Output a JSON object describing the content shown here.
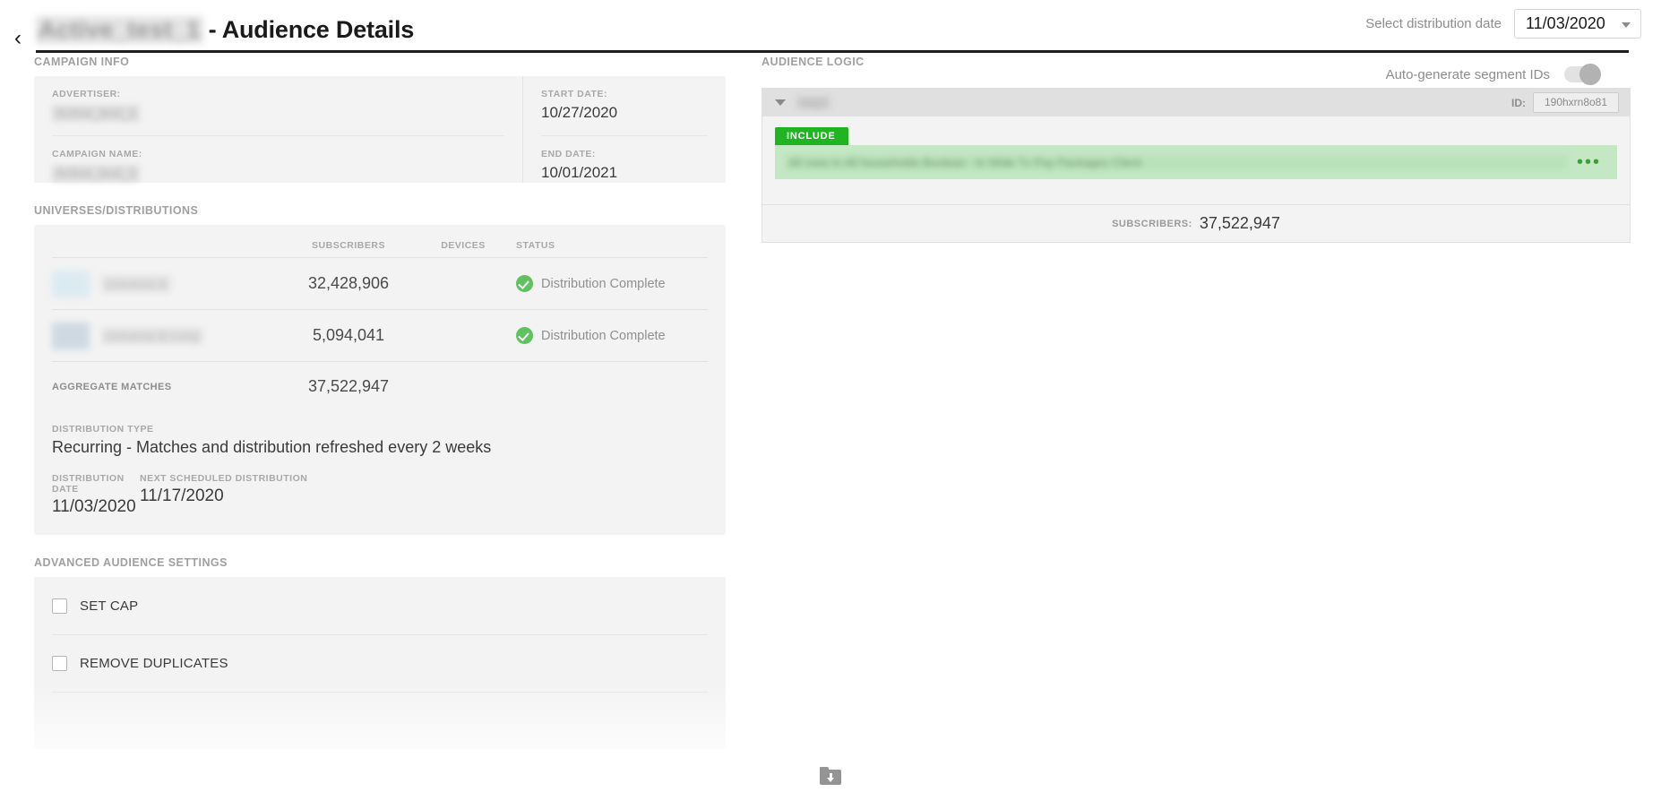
{
  "header": {
    "back_icon": "chevron-left-icon",
    "campaign_name_redacted": "Active_test_1",
    "title_suffix": "- Audience Details",
    "date_select_label": "Select distribution date",
    "date_select_value": "11/03/2020"
  },
  "campaign_info": {
    "section_label": "CAMPAIGN INFO",
    "fields": [
      {
        "key": "ADVERTISER:",
        "value": "Active_test_1",
        "redacted": true
      },
      {
        "key": "CAMPAIGN NAME:",
        "value": "Active_test_1",
        "redacted": true
      }
    ],
    "dates": [
      {
        "key": "START DATE:",
        "value": "10/27/2020"
      },
      {
        "key": "END DATE:",
        "value": "10/01/2021"
      }
    ]
  },
  "universes": {
    "section_label": "UNIVERSES/DISTRIBUTIONS",
    "columns": [
      "",
      "SUBSCRIBERS",
      "DEVICES",
      "STATUS"
    ],
    "rows": [
      {
        "name": "Universe A",
        "subscribers": "32,428,906",
        "devices": "",
        "status": "Distribution Complete",
        "status_icon": "check-circle-icon"
      },
      {
        "name": "Universe B Long",
        "subscribers": "5,094,041",
        "devices": "",
        "status": "Distribution Complete",
        "status_icon": "check-circle-icon"
      }
    ],
    "aggregate_label": "AGGREGATE MATCHES",
    "aggregate_value": "37,522,947",
    "distribution_type_label": "DISTRIBUTION TYPE",
    "distribution_type_value": "Recurring - Matches and distribution refreshed every 2 weeks",
    "distribution_date_label": "DISTRIBUTION DATE",
    "distribution_date_value": "11/03/2020",
    "next_distribution_label": "NEXT SCHEDULED DISTRIBUTION",
    "next_distribution_value": "11/17/2020"
  },
  "advanced": {
    "section_label": "ADVANCED AUDIENCE SETTINGS",
    "options": [
      {
        "label": "SET CAP",
        "checked": false
      },
      {
        "label": "REMOVE DUPLICATES",
        "checked": false
      }
    ]
  },
  "audience_logic": {
    "section_label": "AUDIENCE LOGIC",
    "toggle_label": "Auto-generate segment IDs",
    "toggle_on": false,
    "segment": {
      "name_redacted": "seg1",
      "id_label": "ID:",
      "id_value": "190hxrn8o81",
      "include_badge": "INCLUDE",
      "rule_text_redacted": "All rows in All households Boolean : In Wide Tv Pay Packages Client",
      "overflow_icon": "ellipsis-icon",
      "subscribers_label": "SUBSCRIBERS:",
      "subscribers_value": "37,522,947"
    }
  },
  "footer": {
    "download_icon": "folder-download-icon"
  },
  "colors": {
    "accent_green": "#21b422",
    "status_green": "#5fc15f",
    "rule_bg": "#c4e8c4",
    "card_bg": "#f3f3f3",
    "segment_head_bg": "#e0e0e0"
  }
}
